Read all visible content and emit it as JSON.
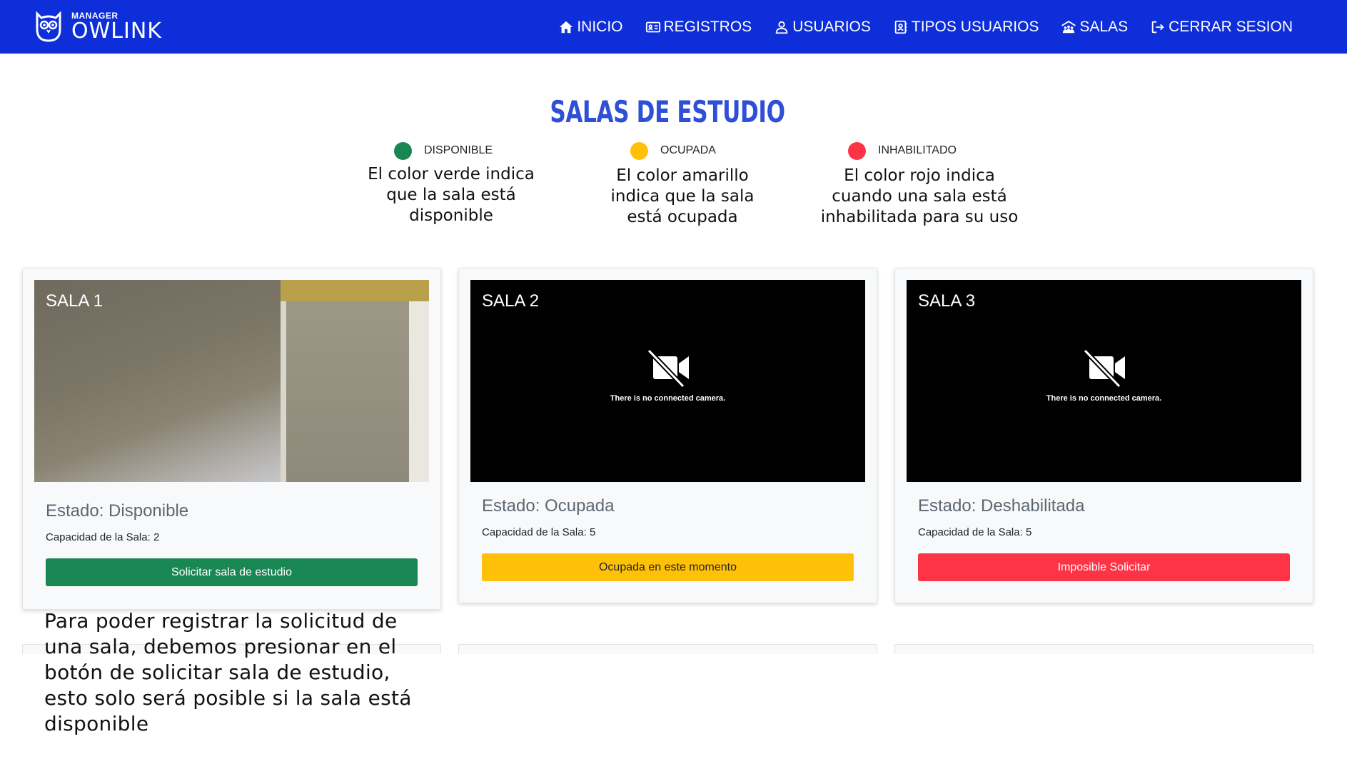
{
  "brand": {
    "small": "MANAGER",
    "big": "OWLINK"
  },
  "nav": [
    {
      "label": "INICIO",
      "icon": "home-icon"
    },
    {
      "label": "REGISTROS",
      "icon": "id-card-icon"
    },
    {
      "label": "USUARIOS",
      "icon": "user-icon"
    },
    {
      "label": "TIPOS USUARIOS",
      "icon": "address-book-icon"
    },
    {
      "label": "SALAS",
      "icon": "people-roof-icon"
    },
    {
      "label": "CERRAR SESION",
      "icon": "logout-icon"
    }
  ],
  "title": "SALAS DE ESTUDIO",
  "legend": [
    {
      "label": "DISPONIBLE",
      "color": "#198754",
      "note": "El color verde indica que la sala está disponible"
    },
    {
      "label": "OCUPADA",
      "color": "#ffc107",
      "note": "El color amarillo indica que la sala está ocupada"
    },
    {
      "label": "INHABILITADO",
      "color": "#fd3346",
      "note": "El color rojo indica cuando una sala está inhabilitada para su uso"
    }
  ],
  "rooms": [
    {
      "name": "SALA 1",
      "estado": "Estado: Disponible",
      "capacidad": "Capacidad de la Sala: 2",
      "button": "Solicitar sala de estudio",
      "button_color": "#198754",
      "camera": "connected"
    },
    {
      "name": "SALA 2",
      "estado": "Estado: Ocupada",
      "capacidad": "Capacidad de la Sala: 5",
      "button": "Ocupada en este momento",
      "button_color": "#ffc107",
      "camera": "There is no connected camera."
    },
    {
      "name": "SALA 3",
      "estado": "Estado: Deshabilitada",
      "capacidad": "Capacidad de la Sala: 5",
      "button": "Imposible Solicitar",
      "button_color": "#fd3346",
      "camera": "There is no connected camera."
    }
  ],
  "bottom_note": "Para poder registrar la solicitud de una sala, debemos presionar en el botón de solicitar sala de estudio, esto solo será posible si la sala está disponible"
}
